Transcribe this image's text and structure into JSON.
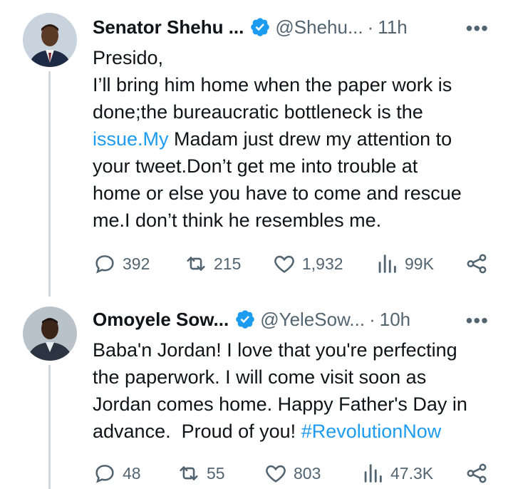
{
  "tweets": [
    {
      "name": "Senator Shehu ...",
      "handle": "@Shehu...",
      "time": "11h",
      "dot": "·",
      "more": "•••",
      "body_lines": [
        "Presido,",
        "I’ll bring him home when the paper work is",
        "done;the bureaucratic bottleneck is the"
      ],
      "body_link": "issue.My",
      "body_after_link": " Madam just drew my attention to",
      "body_lines_2": [
        "your tweet.Don’t get me into trouble at",
        "home or else you have to come and rescue",
        "me.I don’t think he resembles me."
      ],
      "replies": "392",
      "retweets": "215",
      "likes": "1,932",
      "views": "99K"
    },
    {
      "name": "Omoyele Sow...",
      "handle": "@YeleSow...",
      "time": "10h",
      "dot": "·",
      "more": "•••",
      "body_lines": [
        "Baba'n Jordan! I love that you're perfecting",
        "the paperwork. I will come visit soon as",
        "Jordan comes home. Happy Father's Day in"
      ],
      "body_last_prefix": "advance.  Proud of you! ",
      "hashtag": "#RevolutionNow",
      "replies": "48",
      "retweets": "55",
      "likes": "803",
      "views": "47.3K"
    }
  ],
  "colors": {
    "link": "#1d9bf0",
    "verified": "#1d9bf0",
    "muted": "#536471",
    "thread_line": "#cfd9de"
  },
  "icons": [
    "reply-icon",
    "retweet-icon",
    "like-icon",
    "views-icon",
    "share-icon",
    "verified-badge-icon",
    "more-icon"
  ]
}
